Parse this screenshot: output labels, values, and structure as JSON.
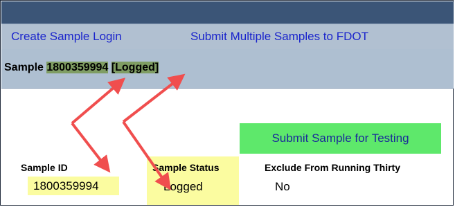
{
  "nav": {
    "create_link": "Create Sample Login",
    "submit_multiple_link": "Submit Multiple Samples to FDOT"
  },
  "sample_header": {
    "prefix": "Sample ",
    "sample_number": "1800359994",
    "status_tag": "[Logged]"
  },
  "actions": {
    "submit_button": "Submit Sample for Testing"
  },
  "fields": {
    "sample_id_label": "Sample ID",
    "sample_id_value": "1800359994",
    "sample_status_label": "Sample Status",
    "sample_status_value": "Logged",
    "exclude_label": "Exclude From Running Thirty",
    "exclude_value": "No"
  },
  "colors": {
    "header_bar": "#3b5577",
    "link_bar": "#b1c0d1",
    "link_text": "#1a24cc",
    "highlight_green": "#7f9d63",
    "highlight_yellow": "#fbfca0",
    "button_green": "#5ee86b",
    "annotation_arrow": "#f04e4e"
  }
}
